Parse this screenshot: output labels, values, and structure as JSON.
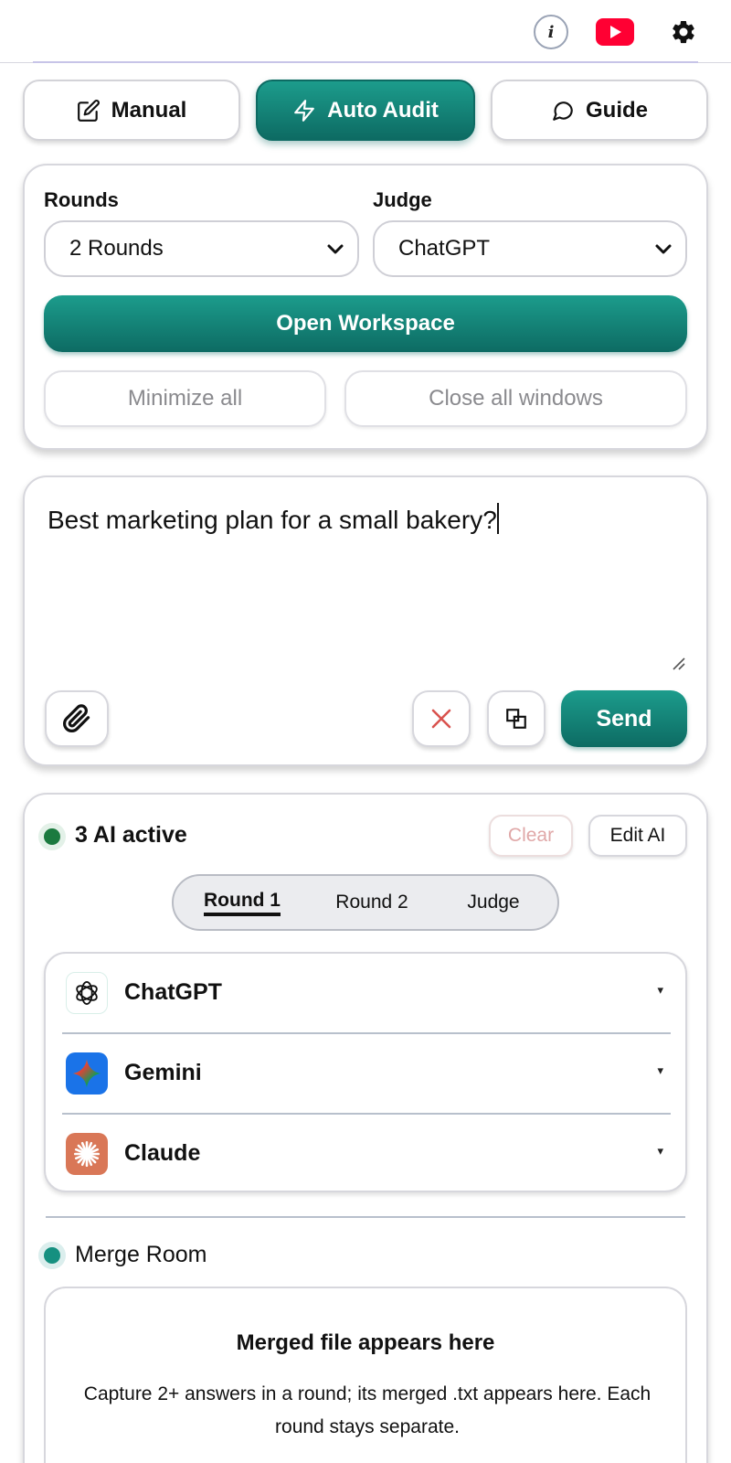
{
  "header": {
    "info_glyph": "i",
    "icons": [
      "info-icon",
      "youtube-icon",
      "gear-icon"
    ]
  },
  "modes": [
    {
      "label": "Manual",
      "icon": "edit-icon",
      "active": false
    },
    {
      "label": "Auto Audit",
      "icon": "lightning-icon",
      "active": true
    },
    {
      "label": "Guide",
      "icon": "chat-bubble-icon",
      "active": false
    }
  ],
  "settings": {
    "rounds_label": "Rounds",
    "rounds_value": "2 Rounds",
    "judge_label": "Judge",
    "judge_value": "ChatGPT",
    "open_workspace": "Open Workspace",
    "minimize_all": "Minimize all",
    "close_all": "Close all windows"
  },
  "composer": {
    "text": "Best marketing plan for a small bakery?",
    "send_label": "Send",
    "icons": [
      "paperclip-icon",
      "clear-x-icon",
      "copy-icon"
    ]
  },
  "active_panel": {
    "status_text": "3 AI active",
    "clear_label": "Clear",
    "edit_label": "Edit AI",
    "tabs": [
      "Round 1",
      "Round 2",
      "Judge"
    ],
    "active_tab": 0,
    "ais": [
      {
        "name": "ChatGPT",
        "arrow": "▾",
        "logo_color": "#ffffff"
      },
      {
        "name": "Gemini",
        "arrow": "▾",
        "logo_color": "#1a73e8"
      },
      {
        "name": "Claude",
        "arrow": "▾",
        "logo_color": "#d97757"
      }
    ]
  },
  "merge_room": {
    "title": "Merge Room",
    "box_title": "Merged file appears here",
    "box_desc": "Capture 2+ answers in a round; its merged .txt appears here. Each round stays separate."
  },
  "colors": {
    "accent": "#0d6b63",
    "accent_light": "#1c9c8c",
    "status_green": "#1b7a3f",
    "merge_teal": "#159080",
    "clear_disabled": "#e0a8a8",
    "youtube_red": "#ff0033"
  }
}
